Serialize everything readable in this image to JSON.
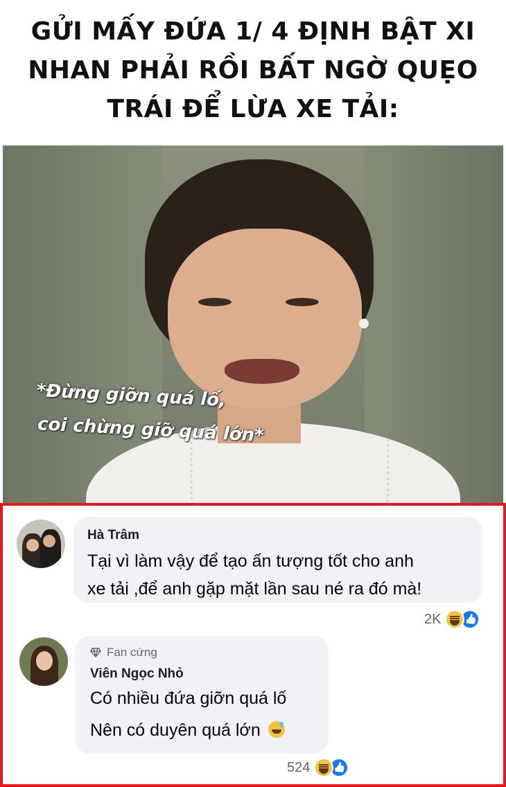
{
  "headline": {
    "text": "GỬI MẤY ĐỨA 1/ 4 ĐỊNH BẬT XI\nNHAN PHẢI RỒI BẤT NGỜ QUẸO\nTRÁI ĐỂ LỪA XE TẢI:"
  },
  "photo": {
    "caption_line1": "*Đừng giỡn quá lố,",
    "caption_line2": "coi chừng giỡ quá lớn*"
  },
  "comments": [
    {
      "author": "Hà Trâm",
      "line1": "Tại vì làm vậy để tạo ấn tượng tốt cho anh",
      "line2": "xe tải ,để anh gặp mặt lần sau né ra đó mà!",
      "reaction_count": "2K",
      "reaction_icons": [
        "haha-icon",
        "like-icon"
      ]
    },
    {
      "badge": "Fan cứng",
      "badge_icon": "diamond-icon",
      "author": "Viên Ngọc Nhỏ",
      "line1": "Có nhiều đứa giỡn quá lố",
      "line2": "Nên có duyên quá lớn",
      "line2_emoji": "sweat-smile-emoji",
      "reaction_count": "524",
      "reaction_icons": [
        "haha-icon",
        "like-icon"
      ]
    }
  ],
  "colors": {
    "highlight_border": "#e8151b",
    "bubble_bg": "#f0f2f5",
    "like_blue": "#1877f2",
    "haha_yellow": "#f7c23a"
  }
}
